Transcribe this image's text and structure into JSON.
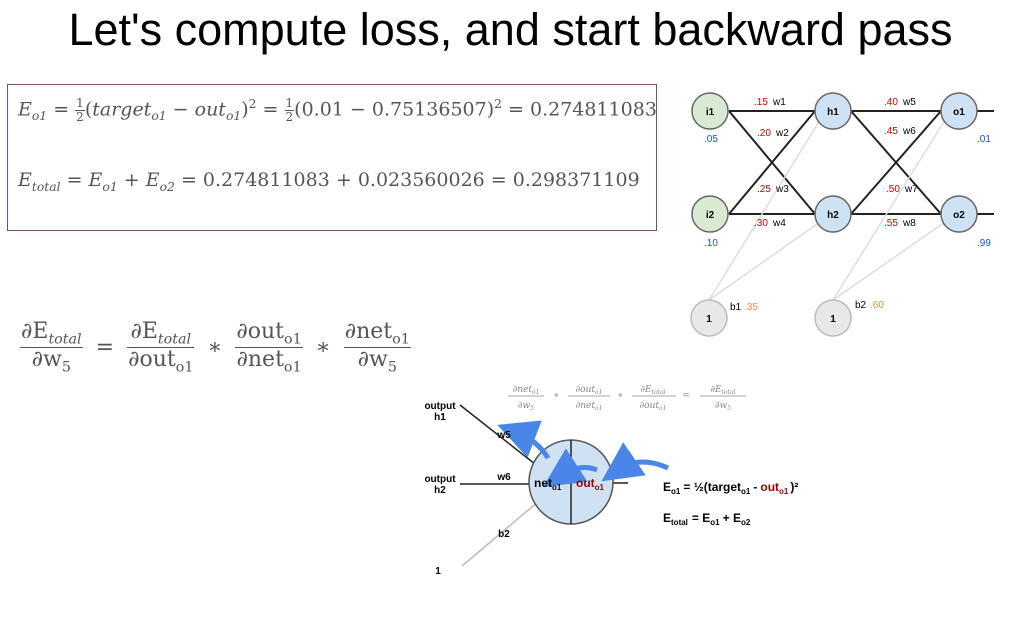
{
  "title": "Let's compute loss, and start backward pass",
  "eq1": {
    "lhs": "E",
    "lhs_sub": "o1",
    "half": "1",
    "half_den": "2",
    "target": "target",
    "target_sub": "o1",
    "out": "out",
    "out_sub": "o1",
    "sq": "2",
    "numeric": "(0.01 − 0.75136507)",
    "result": "= 0.274811083"
  },
  "eq2": {
    "text": "= 0.274811083 + 0.023560026 = 0.298371109",
    "lhs": "E",
    "lhs_sub": "total",
    "t1": "E",
    "t1_sub": "o1",
    "t2": "E",
    "t2_sub": "o2"
  },
  "chain": {
    "dE": "∂E",
    "total": "total",
    "dw": "∂w",
    "w_sub": "5",
    "dout": "∂out",
    "o1": "o1",
    "dnet": "∂net"
  },
  "network": {
    "nodes": {
      "i1": "i1",
      "i2": "i2",
      "h1": "h1",
      "h2": "h2",
      "o1": "o1",
      "o2": "o2",
      "b1": "1",
      "b2": "1"
    },
    "inputs": {
      "i1": ".05",
      "i2": ".10"
    },
    "targets": {
      "o1": ".01",
      "o2": ".99"
    },
    "weights": {
      "w1": ".15",
      "w1_label": "w1",
      "w2": ".20",
      "w2_label": "w2",
      "w3": ".25",
      "w3_label": "w3",
      "w4": ".30",
      "w4_label": "w4",
      "w5": ".40",
      "w5_label": "w5",
      "w6": ".45",
      "w6_label": "w6",
      "w7": ".50",
      "w7_label": "w7",
      "w8": ".55",
      "w8_label": "w8"
    },
    "biases": {
      "b1_label": "b1",
      "b1": ".35",
      "b2_label": "b2",
      "b2": ".60"
    },
    "colors": {
      "input": "#d9ead3",
      "hidden": "#cfe2f3",
      "bias": "#e8e8e8",
      "weight": "#cc0000",
      "value": "#1155cc",
      "bias_value": "#e69138"
    }
  },
  "neuron_diagram": {
    "output_h1": "output",
    "h1": "h1",
    "output_h2": "output",
    "h2": "h2",
    "w5": "w5",
    "w6": "w6",
    "b2": "b2",
    "one": "1",
    "net": "net",
    "net_sub": "o1",
    "out": "out",
    "out_sub": "o1",
    "formula1_lhs": "E",
    "formula1_lhs_sub": "o1",
    "formula1_mid": "= ½(target",
    "formula1_target_sub": "o1",
    "formula1_minus": "-",
    "formula1_out": "out",
    "formula1_out_sub": "o1",
    "formula1_end": ")²",
    "formula2_lhs": "E",
    "formula2_lhs_sub": "total",
    "formula2_rhs": "= E",
    "formula2_t1_sub": "o1",
    "formula2_plus": "+ E",
    "formula2_t2_sub": "o2",
    "mini_chain": {
      "dnet": "∂net",
      "dout": "∂out",
      "dE": "∂E",
      "total": "total",
      "o1": "o1",
      "dw": "∂w",
      "w_sub": "5"
    },
    "colors": {
      "arrow": "#4a86e8",
      "neuron": "#cfe2f3",
      "out_red": "#990000"
    }
  }
}
